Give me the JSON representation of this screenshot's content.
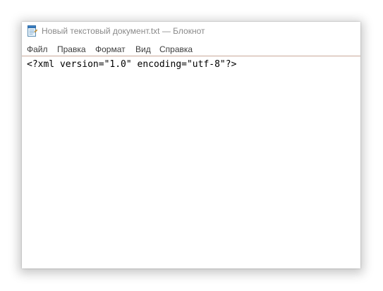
{
  "window": {
    "title": "Новый текстовый документ.txt — Блокнот",
    "icon": "notepad-icon"
  },
  "menu": {
    "items": [
      {
        "label": "Файл"
      },
      {
        "label": "Правка"
      },
      {
        "label": "Формат"
      },
      {
        "label": "Вид"
      },
      {
        "label": "Справка"
      }
    ]
  },
  "editor": {
    "lines": [
      "<?xml version=\"1.0\" encoding=\"utf-8\"?>"
    ]
  },
  "colors": {
    "menu_separator": "#c9a89a",
    "title_text": "#8a8a8a"
  }
}
